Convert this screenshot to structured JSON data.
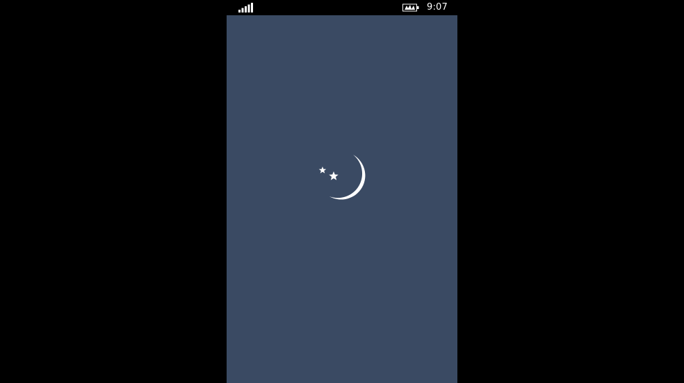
{
  "status_bar": {
    "signal_icon": "signal-strength-icon",
    "battery_icon": "battery-saver-icon",
    "time": "9:07"
  },
  "splash": {
    "background_color": "#3a4a63",
    "logo_icon": "moon-and-stars-icon",
    "logo_color": "#ffffff"
  }
}
